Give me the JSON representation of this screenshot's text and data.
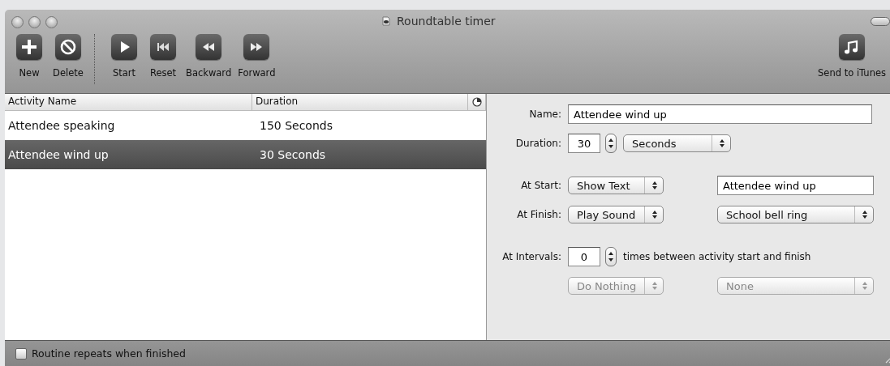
{
  "window": {
    "title": "Roundtable timer"
  },
  "toolbar": {
    "groups": [
      [
        {
          "label": "New"
        },
        {
          "label": "Delete"
        }
      ],
      [
        {
          "label": "Start"
        },
        {
          "label": "Reset"
        },
        {
          "label": "Backward"
        },
        {
          "label": "Forward"
        }
      ]
    ],
    "right": [
      {
        "label": "Send to iTunes"
      }
    ]
  },
  "table": {
    "columns": [
      "Activity Name",
      "Duration"
    ],
    "rows": [
      {
        "cells": [
          "Attendee speaking",
          "150 Seconds"
        ],
        "selected": false
      },
      {
        "cells": [
          "Attendee wind up",
          "30 Seconds"
        ],
        "selected": true
      }
    ]
  },
  "detail": {
    "sections": [
      [
        {
          "label": "Name:",
          "controls": [
            {
              "kind": "text",
              "value": "Attendee wind up"
            }
          ]
        },
        {
          "label": "Duration:",
          "controls": [
            {
              "kind": "number",
              "value": "30"
            },
            {
              "kind": "select",
              "value": "Seconds",
              "disabled": false
            }
          ]
        }
      ],
      [
        {
          "label": "At Start:",
          "controls": [
            {
              "kind": "select",
              "value": "Show Text",
              "disabled": false
            },
            {
              "kind": "text",
              "value": "Attendee wind up"
            }
          ]
        },
        {
          "label": "At Finish:",
          "controls": [
            {
              "kind": "select",
              "value": "Play Sound",
              "disabled": false
            },
            {
              "kind": "select",
              "value": "School bell ring",
              "disabled": false
            }
          ]
        }
      ],
      [
        {
          "label": "At Intervals:",
          "controls": [
            {
              "kind": "number",
              "value": "0"
            },
            {
              "kind": "note",
              "value": "times between activity start and finish"
            }
          ]
        },
        {
          "controls": [
            {
              "kind": "select",
              "value": "Do Nothing",
              "disabled": true
            },
            {
              "kind": "select",
              "value": "None",
              "disabled": true
            }
          ]
        }
      ]
    ]
  },
  "status_bar": {
    "checkbox": {
      "label": "Routine repeats when finished",
      "checked": false
    }
  }
}
